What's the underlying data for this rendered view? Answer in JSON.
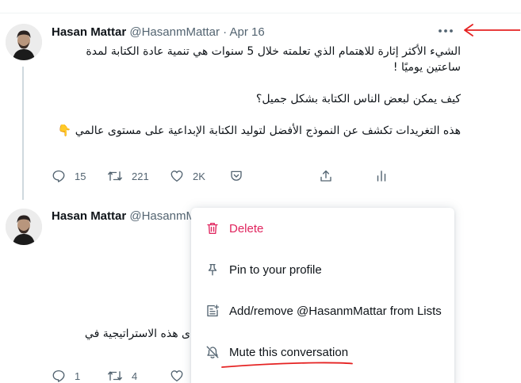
{
  "tweets": [
    {
      "author": "Hasan Mattar",
      "handle": "@HasanmMattar",
      "date": "· Apr 16",
      "paragraphs": [
        "الشيء الأكثر إثارة للاهتمام الذي تعلمته خلال 5 سنوات هي تنمية عادة الكتابة لمدة ساعتين يوميًا !",
        "",
        "كيف يمكن لبعض الناس الكتابة بشكل جميل؟",
        "",
        "هذه التغريدات تكشف عن النموذج الأفضل لتوليد الكتابة الإبداعية على مستوى عالمي 👇"
      ],
      "replies": "15",
      "retweets": "221",
      "likes": "2K"
    },
    {
      "author": "Hasan Mattar",
      "handle": "@HasanmM",
      "partial_text": "ى هذه الاستراتيجية في",
      "replies": "1",
      "retweets": "4"
    }
  ],
  "menu": {
    "items": [
      {
        "label": "Delete",
        "icon": "trash-icon"
      },
      {
        "label": "Pin to your profile",
        "icon": "pin-icon"
      },
      {
        "label": "Add/remove @HasanmMattar from Lists",
        "icon": "list-add-icon"
      },
      {
        "label": "Mute this conversation",
        "icon": "mute-icon"
      }
    ]
  },
  "colors": {
    "danger": "#e0245e",
    "secondary_text": "#536471",
    "annotation": "#e52222",
    "thread_line": "#cfd9de"
  }
}
